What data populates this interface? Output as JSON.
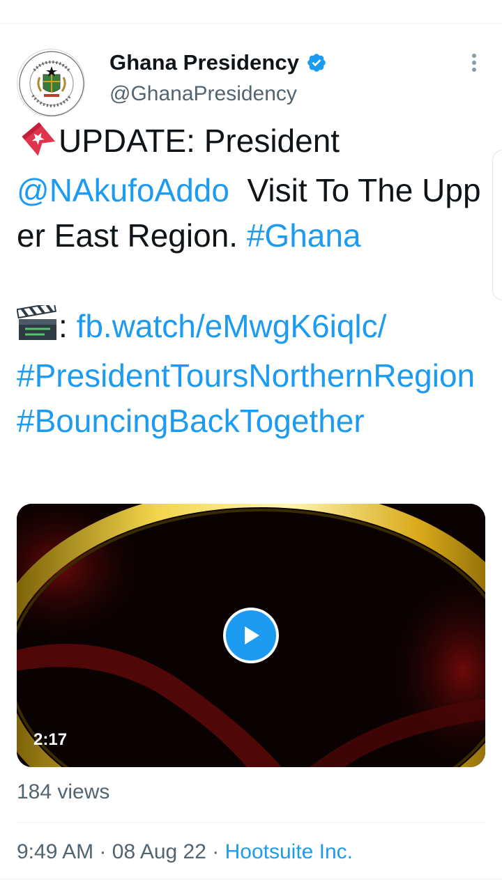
{
  "author": {
    "display_name": "Ghana Presidency",
    "handle": "@GhanaPresidency",
    "avatar_icon": "presidency-seal",
    "verified_icon": "verified-badge-icon"
  },
  "tweet": {
    "emoji_tag": "bookmark-emoji",
    "text_update": "UPDATE: President",
    "mention": "@NAkufoAddo",
    "text_visit": "Visit To The Upper East Region.",
    "hashtag_ghana": "#Ghana",
    "emoji_clapper": "clapper-board-emoji",
    "colon": ":",
    "link": "fb.watch/eMwgK6iqlc/",
    "hashtag_tours": "#PresidentToursNorthernRegion",
    "hashtag_bouncing": "#BouncingBackTogether"
  },
  "media": {
    "duration": "2:17"
  },
  "stats": {
    "views": "184 views"
  },
  "meta": {
    "time": "9:49 AM",
    "separator": "·",
    "date": "08 Aug 22",
    "source": "Hootsuite Inc."
  },
  "colors": {
    "link": "#1d9bf0",
    "secondary_text": "#536471",
    "primary_text": "#0f1419"
  }
}
